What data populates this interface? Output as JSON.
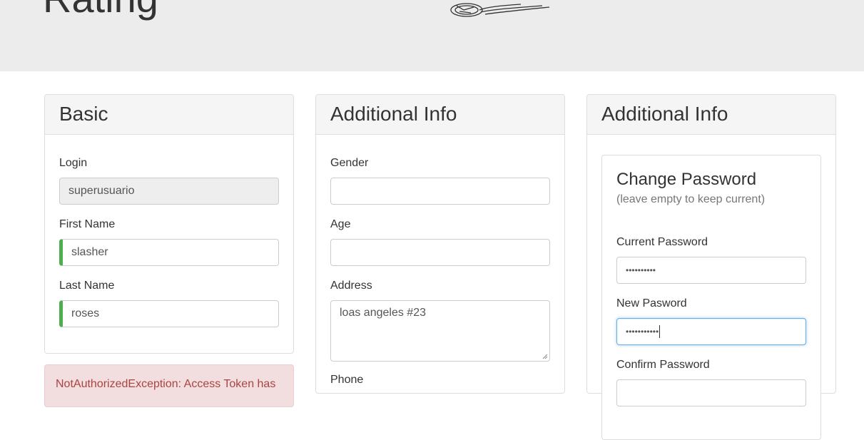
{
  "header": {
    "title": "Rating",
    "logo_icon": "motorcycle-illustration-icon"
  },
  "basic_panel": {
    "title": "Basic",
    "login": {
      "label": "Login",
      "value": "superusuario"
    },
    "first_name": {
      "label": "First Name",
      "value": "slasher"
    },
    "last_name": {
      "label": "Last Name",
      "value": "roses"
    }
  },
  "alert": {
    "text": "NotAuthorizedException: Access Token has"
  },
  "additional_panel": {
    "title": "Additional Info",
    "gender": {
      "label": "Gender",
      "value": ""
    },
    "age": {
      "label": "Age",
      "value": ""
    },
    "address": {
      "label": "Address",
      "value": "loas angeles #23"
    },
    "phone": {
      "label": "Phone"
    }
  },
  "password_panel": {
    "title": "Additional Info",
    "card_title": "Change Password",
    "card_subtitle": "(leave empty to keep current)",
    "current_password": {
      "label": "Current Password",
      "value": "••••••••••"
    },
    "new_password": {
      "label": "New Pasword",
      "value": "•••••••••••"
    },
    "confirm_password": {
      "label": "Confirm Password"
    }
  },
  "colors": {
    "header_bg": "#ececed",
    "valid_accent": "#4cae4c",
    "alert_bg": "#f2dede",
    "alert_text": "#a94442",
    "focus_border": "#66afe9"
  }
}
